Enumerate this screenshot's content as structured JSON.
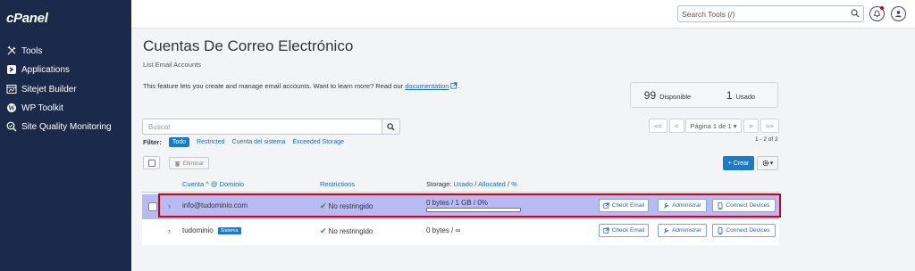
{
  "app": {
    "logo": "cPanel"
  },
  "sidebar": {
    "items": [
      {
        "label": "Tools",
        "icon": "tools-icon"
      },
      {
        "label": "Applications",
        "icon": "applications-icon"
      },
      {
        "label": "Sitejet Builder",
        "icon": "sitejet-icon"
      },
      {
        "label": "WP Toolkit",
        "icon": "wordpress-icon"
      },
      {
        "label": "Site Quality Monitoring",
        "icon": "site-quality-icon"
      }
    ]
  },
  "topbar": {
    "search_placeholder": "Search Tools (/)"
  },
  "page": {
    "title": "Cuentas De Correo Electrónico",
    "subtitle": "List Email Accounts",
    "intro_text": "This feature lets you create and manage email accounts. Want to learn more? Read our",
    "intro_link": "documentation",
    "intro_end": "."
  },
  "stats": {
    "available_num": "99",
    "available_label": "Disponible",
    "used_num": "1",
    "used_label": "Usado"
  },
  "search": {
    "placeholder": "Buscar"
  },
  "pager": {
    "first": "<<",
    "prev": "<",
    "page_label": "Página 1 de 1 ▾",
    "next": ">",
    "last": ">>",
    "range": "1 - 2 of 2"
  },
  "filter": {
    "label": "Filter:",
    "options": [
      "Todo",
      "Restricted",
      "Cuenta del sistema",
      "Exceeded Storage"
    ],
    "active": "Todo"
  },
  "toolbar": {
    "delete_label": "Eliminar",
    "create_label": "+ Crear",
    "gear_caret": "▾"
  },
  "table": {
    "headers": {
      "account": "Cuenta ^ @ Dominio",
      "restrictions": "Restrictions",
      "storage_prefix": "Storage:",
      "storage_used": "Usado",
      "storage_sep1": "/",
      "storage_allocated": "Allocated",
      "storage_sep2": "/",
      "storage_pct": "%"
    },
    "rows": [
      {
        "account": "info@tudominio.com",
        "badge": "",
        "restrictions": "No restringido",
        "storage": "0 bytes / 1 GB / 0%",
        "has_bar": true,
        "usage_percent": 0,
        "check_email": "Check Email",
        "manage": "Administrar",
        "connect": "Connect Devices"
      },
      {
        "account": "tudominio",
        "badge": "Sistema",
        "restrictions": "No restringido",
        "storage": "0 bytes / ∞",
        "has_bar": false,
        "check_email": "Check Email",
        "manage": "Administrar",
        "connect": "Connect Devices"
      }
    ]
  },
  "colors": {
    "sidebar_bg": "#1b2a4a",
    "accent": "#1a7cc4",
    "link": "#1a6bb5",
    "selected_row": "#b8baf4",
    "highlight_outline": "#d0021b"
  }
}
